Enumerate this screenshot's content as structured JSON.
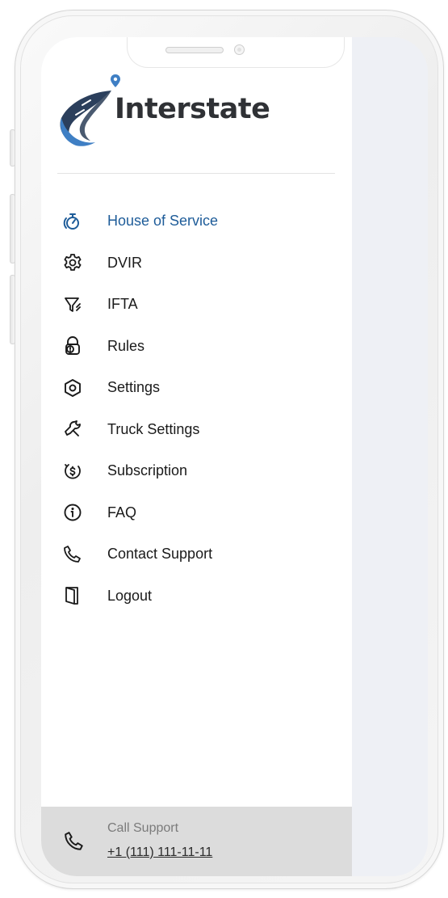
{
  "brand": {
    "name": "Interstate",
    "primary_color": "#1e5c99",
    "logo_mark_colors": [
      "#2b3f5c",
      "#3f7fc4"
    ]
  },
  "menu": {
    "items": [
      {
        "label": "House of Service",
        "icon": "stopwatch-icon",
        "active": true
      },
      {
        "label": "DVIR",
        "icon": "gear-icon",
        "active": false
      },
      {
        "label": "IFTA",
        "icon": "funnel-icon",
        "active": false
      },
      {
        "label": "Rules",
        "icon": "lock-alert-icon",
        "active": false
      },
      {
        "label": "Settings",
        "icon": "hex-settings-icon",
        "active": false
      },
      {
        "label": "Truck Settings",
        "icon": "wrench-icon",
        "active": false
      },
      {
        "label": "Subscription",
        "icon": "dollar-cycle-icon",
        "active": false
      },
      {
        "label": "FAQ",
        "icon": "info-icon",
        "active": false
      },
      {
        "label": "Contact Support",
        "icon": "phone-icon",
        "active": false
      },
      {
        "label": "Logout",
        "icon": "door-icon",
        "active": false
      }
    ]
  },
  "footer": {
    "call_label": "Call Support",
    "phone": "+1 (111) 111-11-11"
  }
}
